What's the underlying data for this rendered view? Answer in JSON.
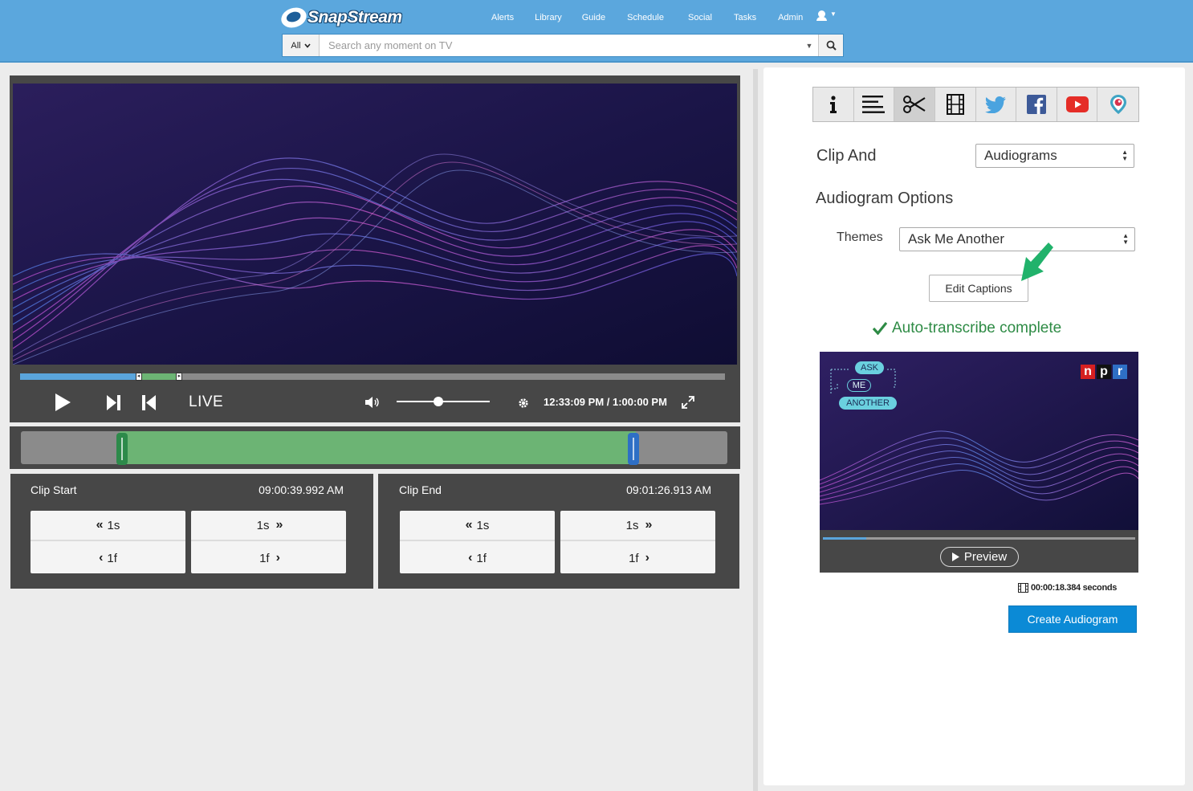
{
  "header": {
    "logo_text": "SnapStream",
    "nav": [
      {
        "label": "Alerts"
      },
      {
        "label": "Library"
      },
      {
        "label": "Guide"
      },
      {
        "label": "Schedule"
      },
      {
        "label": "Social"
      },
      {
        "label": "Tasks"
      },
      {
        "label": "Admin"
      }
    ],
    "search": {
      "scope": "All",
      "placeholder": "Search any moment on TV"
    }
  },
  "player": {
    "live_label": "LIVE",
    "timecode": "12:33:09 PM / 1:00:00 PM",
    "volume_level": 0.45,
    "played_fraction": 0.168,
    "clip_range_fraction": [
      0.14,
      0.87
    ]
  },
  "clip_start": {
    "label": "Clip Start",
    "time": "09:00:39.992 AM",
    "back_second": "1s",
    "forward_second": "1s",
    "back_frame": "1f",
    "forward_frame": "1f"
  },
  "clip_end": {
    "label": "Clip End",
    "time": "09:01:26.913 AM",
    "back_second": "1s",
    "forward_second": "1s",
    "back_frame": "1f",
    "forward_frame": "1f"
  },
  "sidebar": {
    "tabs": [
      {
        "icon": "info-icon"
      },
      {
        "icon": "transcript-icon"
      },
      {
        "icon": "scissors-icon",
        "active": true
      },
      {
        "icon": "film-icon"
      },
      {
        "icon": "twitter-icon"
      },
      {
        "icon": "facebook-icon"
      },
      {
        "icon": "youtube-icon"
      },
      {
        "icon": "periscope-icon"
      }
    ],
    "clip_and_label": "Clip And",
    "clip_and_value": "Audiograms",
    "audiogram_options_label": "Audiogram Options",
    "themes_label": "Themes",
    "themes_value": "Ask Me Another",
    "edit_captions": "Edit Captions",
    "status": "Auto-transcribe complete",
    "preview": {
      "pill_ask": "ASK",
      "pill_me": "ME",
      "pill_another": "ANOTHER",
      "npr": [
        "n",
        "p",
        "r"
      ],
      "button": "Preview",
      "progress_fraction": 0.14
    },
    "duration": "00:00:18.384 seconds",
    "create_button": "Create Audiogram"
  },
  "colors": {
    "header_bg": "#5ba7dd",
    "accent_green": "#2e8b45",
    "primary_button": "#0b8ad6",
    "clip_range": "#6cb474"
  }
}
